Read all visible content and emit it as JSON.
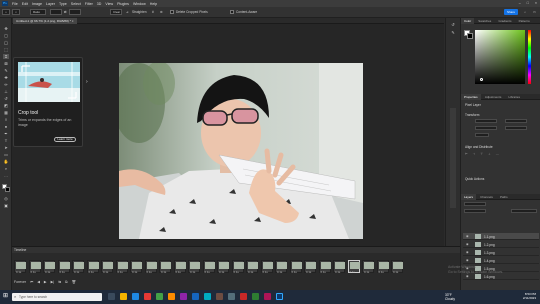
{
  "menubar": {
    "items": [
      "File",
      "Edit",
      "Image",
      "Layer",
      "Type",
      "Select",
      "Filter",
      "3D",
      "View",
      "Plugins",
      "Window",
      "Help"
    ],
    "window_controls": [
      "–",
      "□",
      "×"
    ]
  },
  "options": {
    "ratio": "Ratio",
    "clear": "Clear",
    "straighten": "Straighten",
    "delete_cropped": "Delete Cropped Pixels",
    "content_aware": "Content-Aware",
    "share": "Share"
  },
  "document_tab": "Untitled-1 @ 66.7% (1.2.png, RGB/8#) *",
  "tooltip": {
    "title": "Crop tool",
    "description": "Trims or expands the edges of an image",
    "button": "Learn more"
  },
  "right_panel": {
    "color_tabs": [
      "Color",
      "Swatches",
      "Gradients",
      "Patterns"
    ],
    "properties_tabs": [
      "Properties",
      "Adjustments",
      "Libraries"
    ],
    "properties_subtitle": "Pixel Layer",
    "transform": "Transform",
    "align": "Align and Distribute",
    "quick_actions": "Quick Actions",
    "layers_tabs": [
      "Layers",
      "Channels",
      "Paths"
    ],
    "layers": [
      "1.1.png",
      "1.2.png",
      "1.3.png",
      "1.4.png",
      "1.5.png",
      "1.6.png"
    ]
  },
  "timeline": {
    "title": "Timeline",
    "frame_label": "0.1s",
    "frame_count": 27,
    "selected_frame": 23,
    "loop": "Forever"
  },
  "activate": {
    "line1": "Activate Windows",
    "line2": "Go to Settings to activate Windows."
  },
  "taskbar": {
    "search_placeholder": "Type here to search",
    "weather_temp": "33°F",
    "weather_desc": "Cloudy",
    "time": "8:53 PM",
    "date": "2/11/2023"
  },
  "colors": {
    "accent": "#1473e6",
    "foreground": "#ffffff",
    "background": "#000000"
  }
}
